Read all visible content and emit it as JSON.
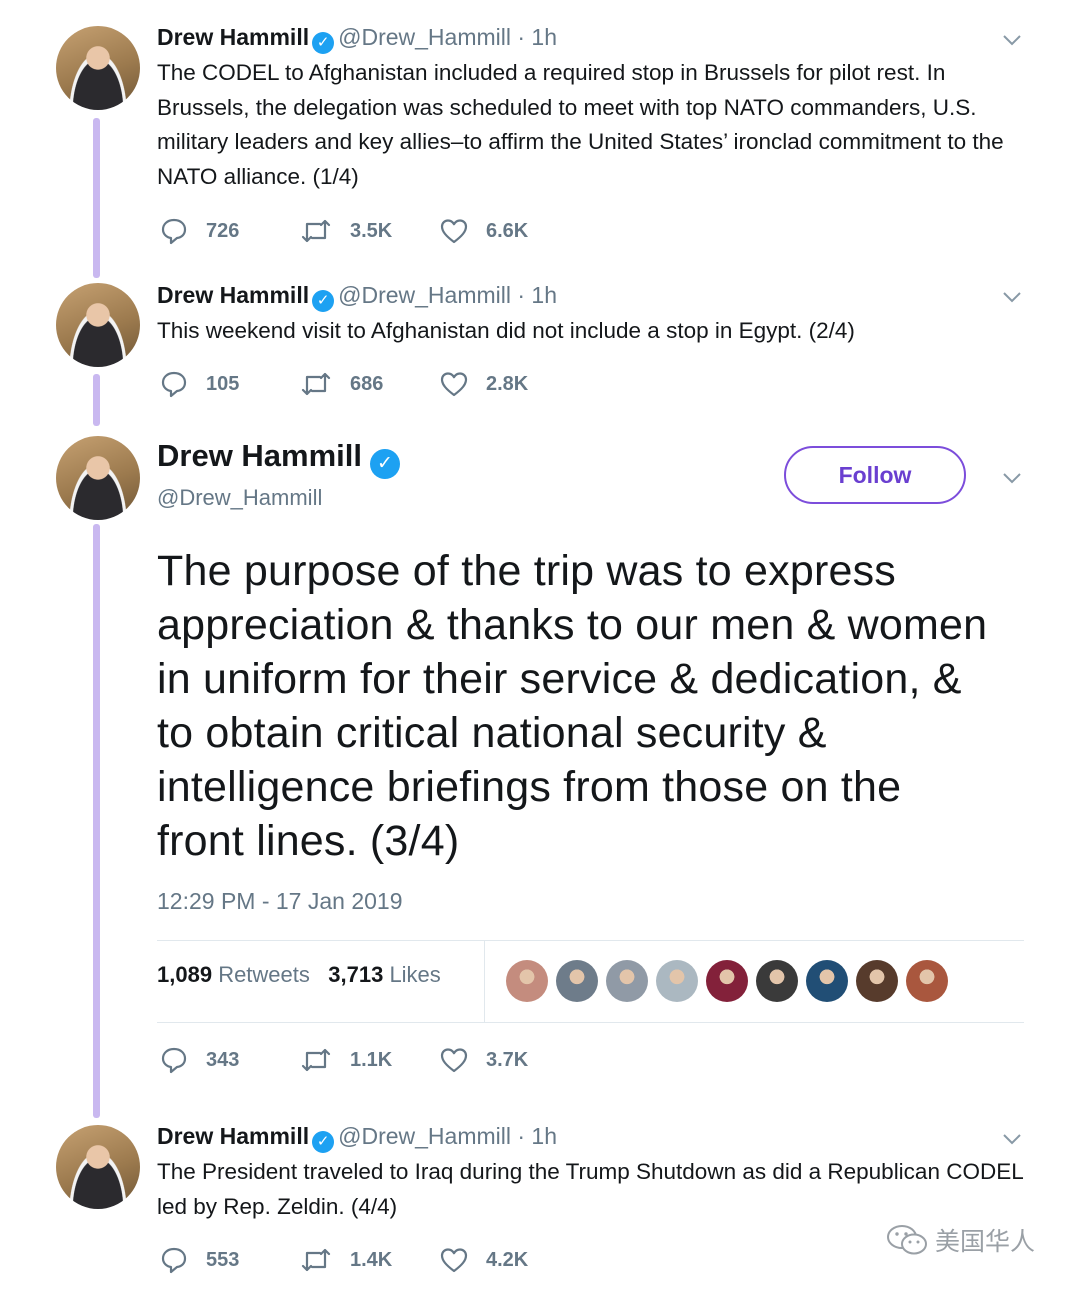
{
  "tweets": [
    {
      "name": "Drew Hammill",
      "verified_mark": "✓",
      "handle": "@Drew_Hammill",
      "age": "· 1h",
      "text": "The CODEL to Afghanistan included a required stop in Brussels for pilot rest.  In Brussels, the delegation was scheduled to meet with top NATO commanders, U.S. military leaders and key allies–to affirm the United States’ ironclad commitment to the NATO alliance. (1/4)",
      "replies": "726",
      "retweets": "3.5K",
      "likes": "6.6K"
    },
    {
      "name": "Drew Hammill",
      "verified_mark": "✓",
      "handle": "@Drew_Hammill",
      "age": "· 1h",
      "text": "This weekend visit to Afghanistan did not include a stop in Egypt.  (2/4)",
      "replies": "105",
      "retweets": "686",
      "likes": "2.8K"
    },
    {
      "name": "Drew Hammill",
      "verified_mark": "✓",
      "handle": "@Drew_Hammill",
      "follow_label": "Follow",
      "text": "The purpose of the trip was to express appreciation & thanks to our men & women in uniform for their service & dedication, & to obtain critical national security & intelligence briefings from those on the front lines. (3/4)",
      "timestamp": "12:29 PM - 17 Jan 2019",
      "retweet_count": "1,089",
      "retweet_label": "Retweets",
      "like_count": "3,713",
      "like_label": "Likes",
      "replies": "343",
      "retweets": "1.1K",
      "likes": "3.7K"
    },
    {
      "name": "Drew Hammill",
      "verified_mark": "✓",
      "handle": "@Drew_Hammill",
      "age": "· 1h",
      "text": "The President traveled to Iraq during the Trump Shutdown as did a Republican CODEL led by Rep. Zeldin. (4/4)",
      "replies": "553",
      "retweets": "1.4K",
      "likes": "4.2K"
    }
  ],
  "likers": [
    "#c98b7b",
    "#6d7c8c",
    "#8f9aa8",
    "#aab8c2",
    "#8b1f3a",
    "#3a3a3a",
    "#1d4f7a",
    "#5a3a2a",
    "#b0553a"
  ],
  "watermark": "美国华人",
  "colors": {
    "accent": "#7c4ddb",
    "thread": "#c9b8f0",
    "verified": "#1da1f2",
    "muted": "#657786"
  },
  "icons": [
    "reply-icon",
    "retweet-icon",
    "like-icon",
    "chevron-down-icon",
    "verified-badge-icon",
    "wechat-icon"
  ]
}
